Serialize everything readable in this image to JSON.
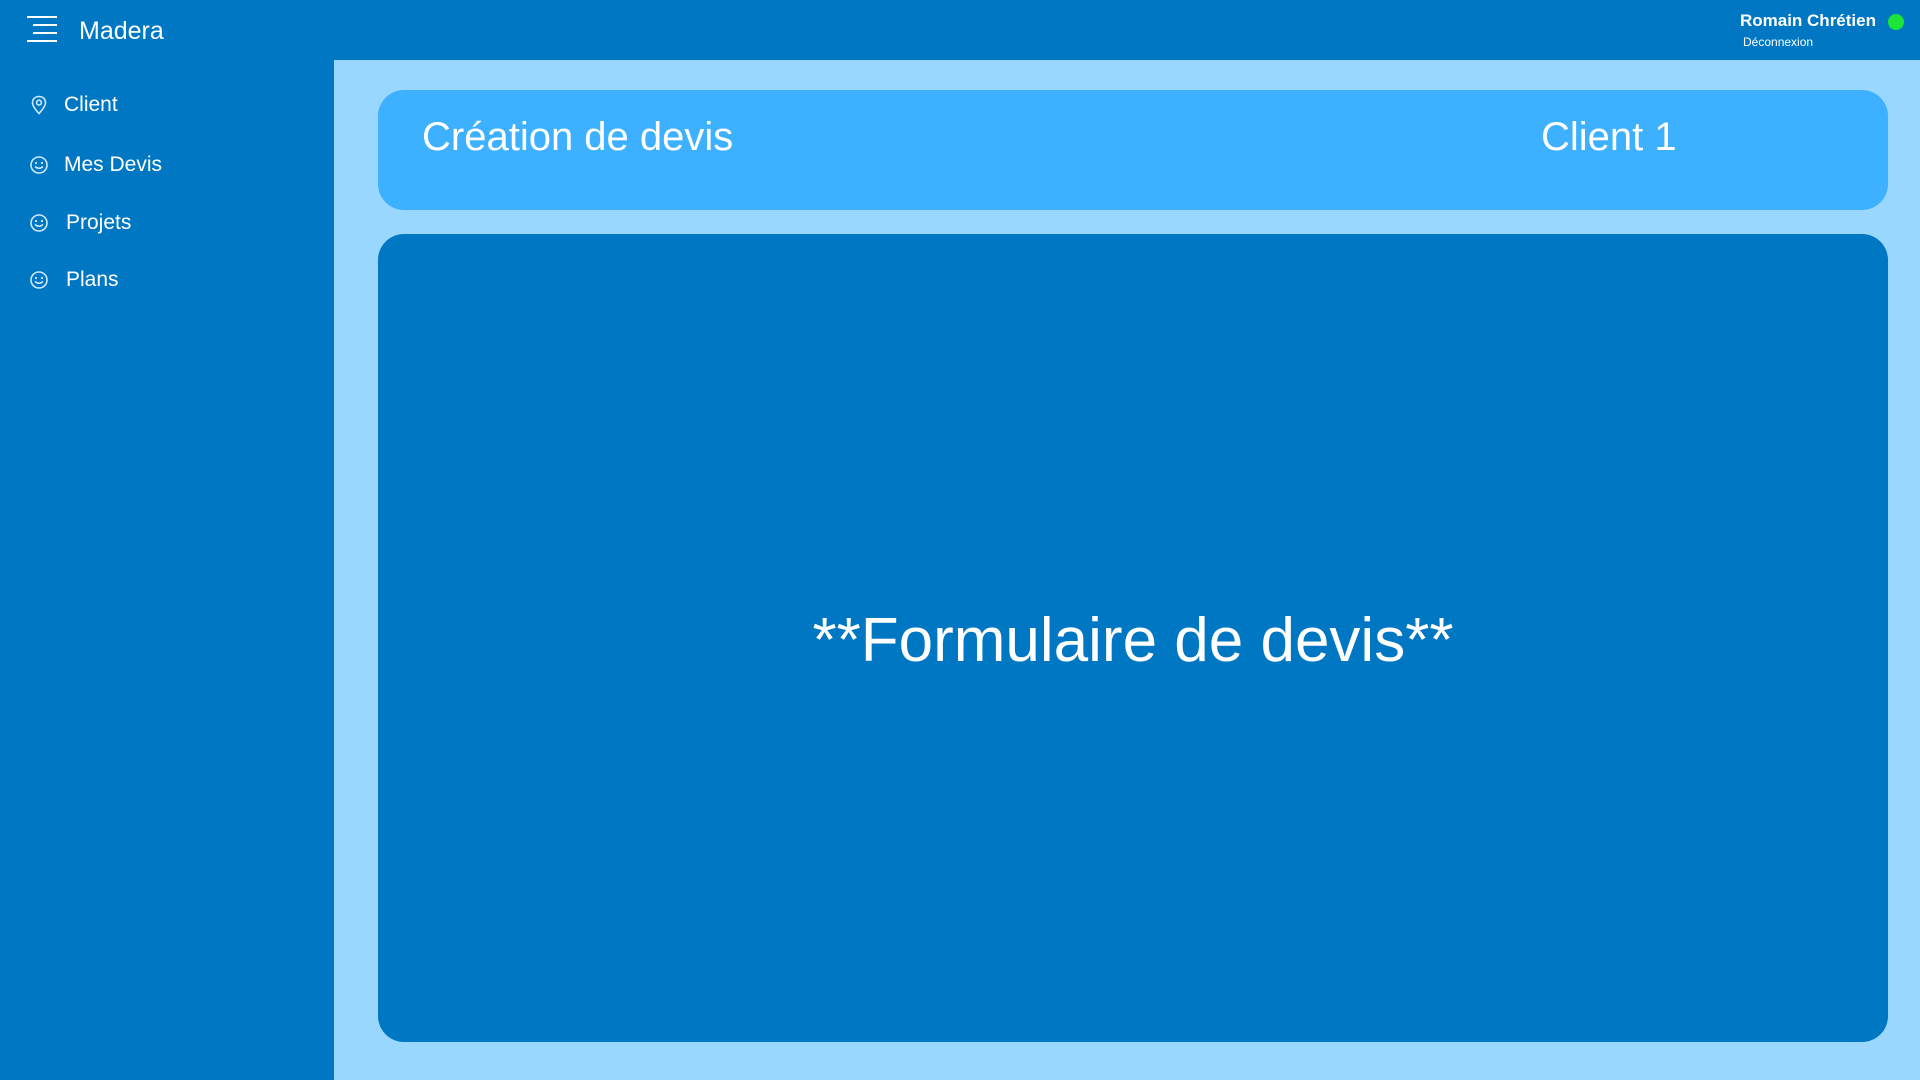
{
  "app": {
    "title": "Madera",
    "menu_icon": "hamburger-menu-icon"
  },
  "user": {
    "name": "Romain Chrétien",
    "logout_label": "Déconnexion",
    "status_color": "#1ee53a"
  },
  "sidebar": {
    "items": [
      {
        "label": "Client",
        "icon": "location-pin-icon"
      },
      {
        "label": "Mes Devis",
        "icon": "smiley-icon"
      },
      {
        "label": "Projets",
        "icon": "smiley-icon"
      },
      {
        "label": "Plans",
        "icon": "smiley-icon"
      }
    ]
  },
  "header": {
    "title": "Création de devis",
    "client": "Client 1"
  },
  "form": {
    "placeholder": "**Formulaire de devis**"
  },
  "colors": {
    "primary": "#0077c2",
    "content_bg": "#9ad7ff",
    "header_card": "#3db0ff"
  }
}
